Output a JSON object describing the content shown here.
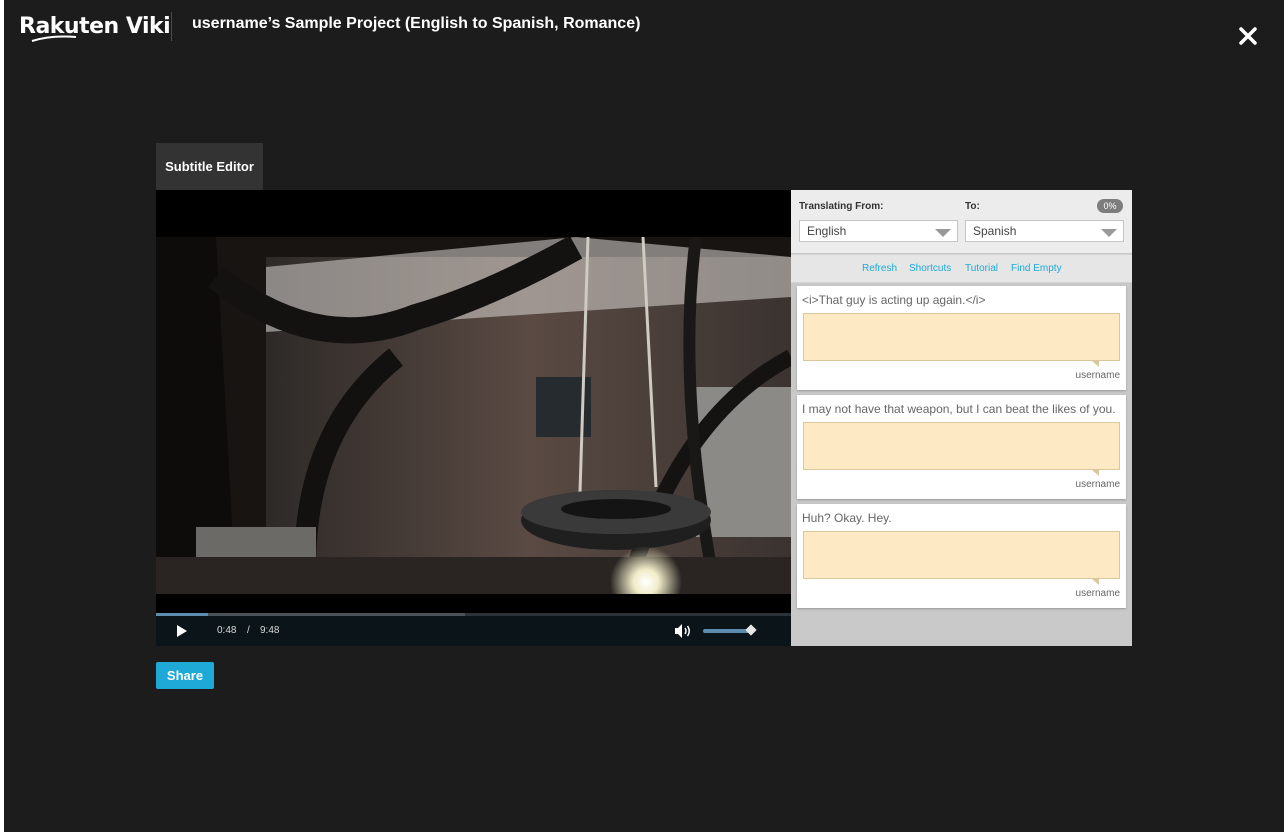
{
  "header": {
    "brand": "Rakuten Viki",
    "project_title": "username’s Sample Project (English to Spanish, Romance)",
    "close_icon": "close-icon"
  },
  "editor_tab": {
    "label": "Subtitle Editor"
  },
  "player": {
    "current_time": "0:48",
    "separator": "/",
    "duration": "9:48",
    "progress_fraction": 0.082,
    "buffered_fraction": 0.486,
    "volume_fraction": 0.95,
    "play_icon": "play-icon",
    "volume_icon": "volume-icon"
  },
  "panel": {
    "from_label": "Translating From:",
    "to_label": "To:",
    "percent": "0%",
    "from_language": "English",
    "to_language": "Spanish",
    "links": [
      "Refresh",
      "Shortcuts",
      "Tutorial",
      "Find Empty"
    ],
    "subtitles": [
      {
        "source": "<i>That guy is acting up again.</i>",
        "translation": "",
        "author": "username"
      },
      {
        "source": "I may not have that weapon, but I can beat the likes of you.",
        "translation": "",
        "author": "username"
      },
      {
        "source": "Huh? Okay. Hey.",
        "translation": "",
        "author": "username"
      }
    ]
  },
  "share_button": {
    "label": "Share"
  },
  "colors": {
    "background": "#1c1c1c",
    "accent": "#1ea9d7",
    "input_fill": "#fdeac4"
  }
}
